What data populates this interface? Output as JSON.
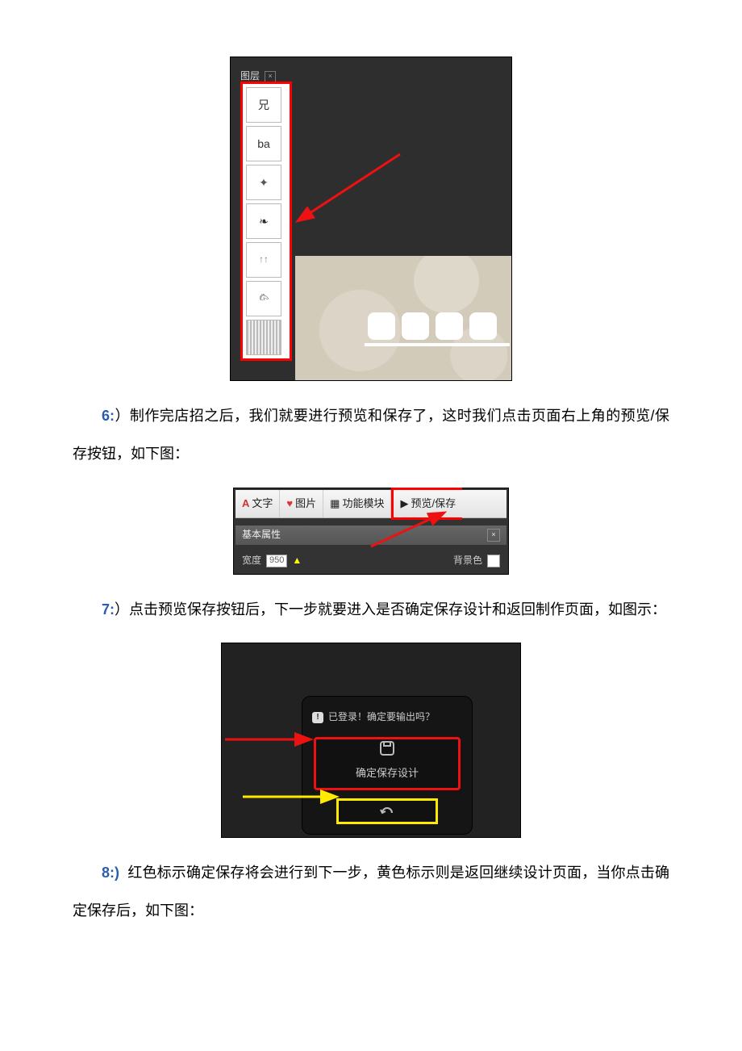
{
  "fig1": {
    "panel_title": "图层",
    "layers": {
      "l1": "兄",
      "l2": "ba"
    }
  },
  "step6": {
    "num": "6:",
    "text": "）制作完店招之后，我们就要进行预览和保存了，这时我们点击页面右上角的预览/保存按钮，如下图："
  },
  "fig2": {
    "btn_text": "文字",
    "btn_image": "图片",
    "btn_module": "功能模块",
    "btn_preview": "预览/保存",
    "subbar": "基本属性",
    "width_label": "宽度",
    "width_value": "950",
    "bg_label": "背景色"
  },
  "step7": {
    "num": "7:",
    "text": "）点击预览保存按钮后，下一步就要进入是否确定保存设计和返回制作页面，如图示："
  },
  "fig3": {
    "title": "已登录！确定要输出吗？",
    "save_label": "确定保存设计"
  },
  "step8": {
    "num": "8:)",
    "text": "红色标示确定保存将会进行到下一步，黄色标示则是返回继续设计页面，当你点击确定保存后，如下图："
  }
}
